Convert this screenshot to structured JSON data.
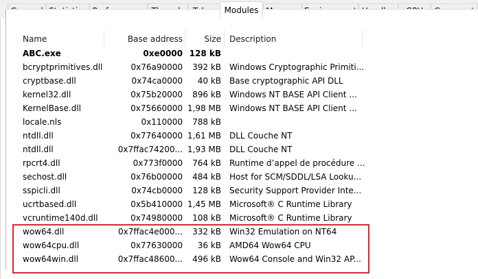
{
  "tabs": [
    {
      "label": "General"
    },
    {
      "label": "Statistics"
    },
    {
      "label": "Performance"
    },
    {
      "label": "Threads"
    },
    {
      "label": "Token"
    },
    {
      "label": "Modules"
    },
    {
      "label": "Memory"
    },
    {
      "label": "Environment"
    },
    {
      "label": "Handles"
    },
    {
      "label": "GPU"
    },
    {
      "label": "Comment"
    }
  ],
  "active_tab": "Modules",
  "columns": {
    "name": "Name",
    "base_address": "Base address",
    "size": "Size",
    "description": "Description"
  },
  "modules": [
    {
      "name": "ABC.exe",
      "base": "0xe0000",
      "size": "128 kB",
      "desc": ""
    },
    {
      "name": "bcryptprimitives.dll",
      "base": "0x76a90000",
      "size": "392 kB",
      "desc": "Windows Cryptographic Primiti..."
    },
    {
      "name": "cryptbase.dll",
      "base": "0x74ca0000",
      "size": "40 kB",
      "desc": "Base cryptographic API DLL"
    },
    {
      "name": "kernel32.dll",
      "base": "0x75b20000",
      "size": "896 kB",
      "desc": "Windows NT BASE API Client ..."
    },
    {
      "name": "KernelBase.dll",
      "base": "0x75660000",
      "size": "1,98 MB",
      "desc": "Windows NT BASE API Client ..."
    },
    {
      "name": "locale.nls",
      "base": "0x110000",
      "size": "788 kB",
      "desc": ""
    },
    {
      "name": "ntdll.dll",
      "base": "0x77640000",
      "size": "1,61 MB",
      "desc": "DLL Couche NT"
    },
    {
      "name": "ntdll.dll",
      "base": "0x7ffac74200...",
      "size": "1,93 MB",
      "desc": "DLL Couche NT"
    },
    {
      "name": "rpcrt4.dll",
      "base": "0x773f0000",
      "size": "764 kB",
      "desc": "Runtime d’appel de procédure ..."
    },
    {
      "name": "sechost.dll",
      "base": "0x76b00000",
      "size": "484 kB",
      "desc": "Host for SCM/SDDL/LSA Looku..."
    },
    {
      "name": "sspicli.dll",
      "base": "0x74cb0000",
      "size": "128 kB",
      "desc": "Security Support Provider Inte..."
    },
    {
      "name": "ucrtbased.dll",
      "base": "0x5b410000",
      "size": "1,45 MB",
      "desc": "Microsoft® C Runtime Library"
    },
    {
      "name": "vcruntime140d.dll",
      "base": "0x74980000",
      "size": "108 kB",
      "desc": "Microsoft® C Runtime Library"
    },
    {
      "name": "wow64.dll",
      "base": "0x7ffac4e000...",
      "size": "332 kB",
      "desc": "Win32 Emulation on NT64"
    },
    {
      "name": "wow64cpu.dll",
      "base": "0x77630000",
      "size": "36 kB",
      "desc": "AMD64 Wow64 CPU"
    },
    {
      "name": "wow64win.dll",
      "base": "0x7ffac48600...",
      "size": "496 kB",
      "desc": "Wow64 Console and Win32 AP..."
    }
  ],
  "colors": {
    "highlight_border": "#e8202a",
    "panel_background": "#ffffff",
    "tabbar_background": "#f0f0f0"
  }
}
